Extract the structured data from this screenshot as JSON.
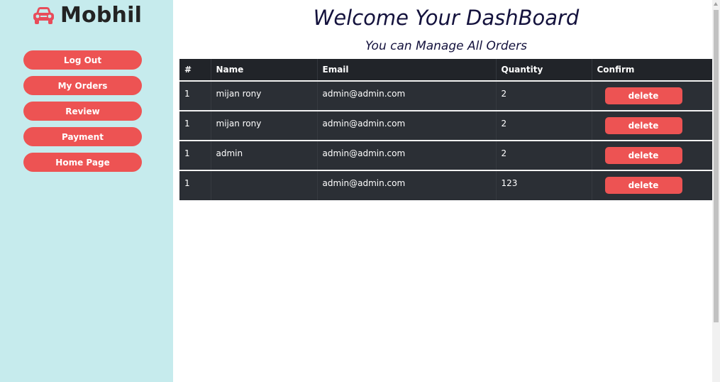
{
  "brand": {
    "name": "Mobhil",
    "icon": "car-icon",
    "icon_color": "#e84c5a"
  },
  "sidebar": {
    "background": "#c6ebed",
    "items": [
      {
        "label": "Log Out"
      },
      {
        "label": "My Orders"
      },
      {
        "label": "Review"
      },
      {
        "label": "Payment"
      },
      {
        "label": "Home Page"
      }
    ]
  },
  "main": {
    "title": "Welcome Your DashBoard",
    "subtitle": "You can Manage All Orders"
  },
  "table": {
    "headers": [
      "#",
      "Name",
      "Email",
      "Quantity",
      "Confirm"
    ],
    "rows": [
      {
        "index": "1",
        "name": "mijan rony",
        "email": "admin@admin.com",
        "quantity": "2",
        "action": "delete"
      },
      {
        "index": "1",
        "name": "mijan rony",
        "email": "admin@admin.com",
        "quantity": "2",
        "action": "delete"
      },
      {
        "index": "1",
        "name": "admin",
        "email": "admin@admin.com",
        "quantity": "2",
        "action": "delete"
      },
      {
        "index": "1",
        "name": "",
        "email": "admin@admin.com",
        "quantity": "123",
        "action": "delete"
      }
    ]
  },
  "colors": {
    "accent": "#ed5353",
    "table_dark": "#2b2f35",
    "title_text": "#14123d"
  }
}
